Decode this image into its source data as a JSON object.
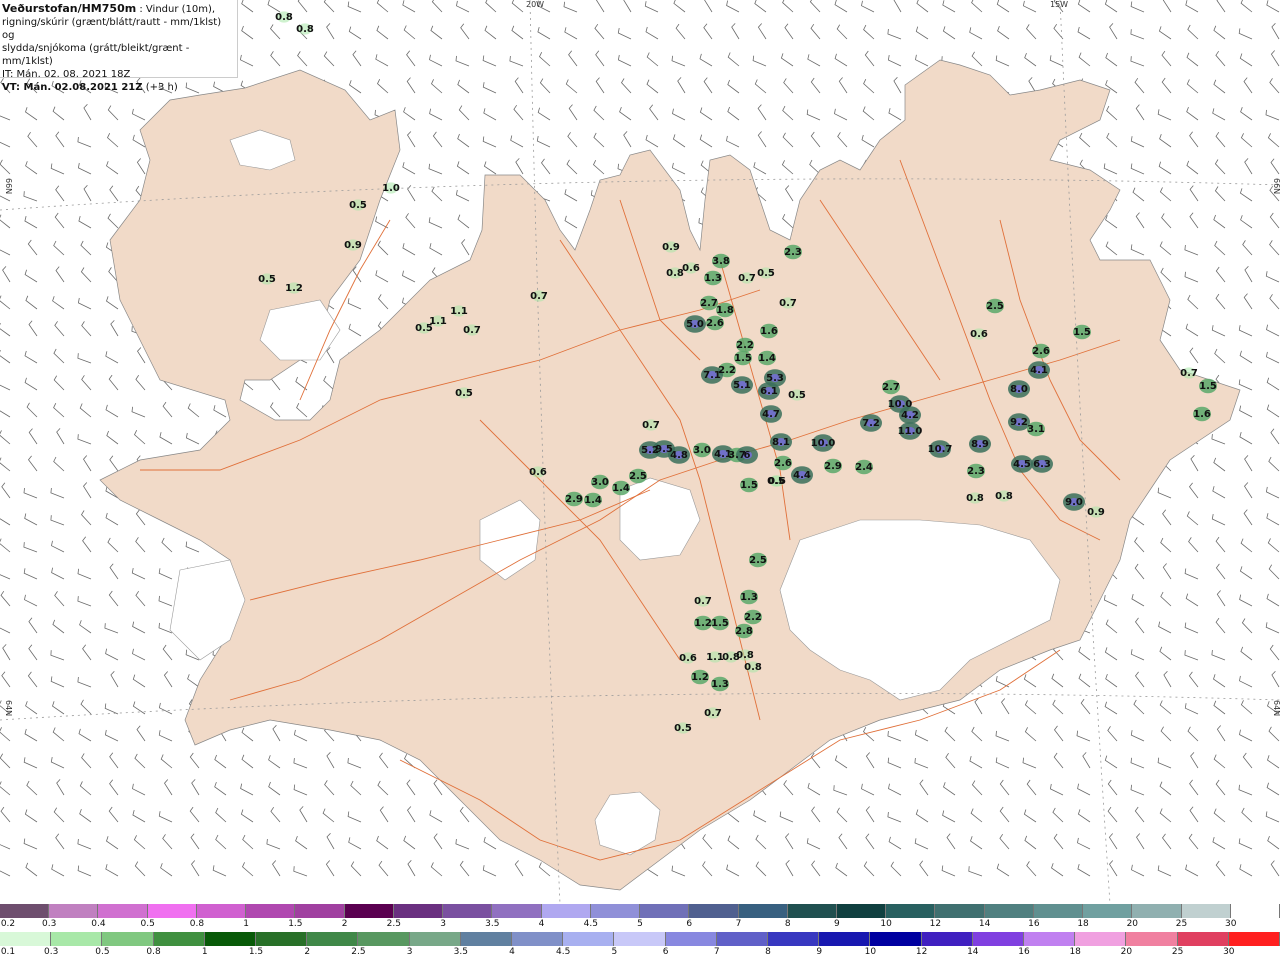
{
  "header": {
    "org": "Veðurstofan/HM750m",
    "desc1": " : Vindur (10m),",
    "desc2": "rigning/skúrir (grænt/blátt/rautt - mm/1klst) og",
    "desc3": "slydda/snjókoma (grátt/bleikt/grænt - mm/1klst)",
    "it": "IT: Mán. 02. 08. 2021 18Z",
    "vt": "VT: Mán. 02.08.2021 21Z",
    "vt_extra": " (+3 h)"
  },
  "grid_labels": {
    "lon_20w": "20W",
    "lon_15w": "15W",
    "lat_66n_left": "66N",
    "lat_66n_right": "66N",
    "lat_64n_left": "64N",
    "lat_64n_right": "64N"
  },
  "colors": {
    "land": "#f1dac8",
    "glacier": "#ffffff",
    "road": "#e0703a",
    "barb": "#6a6a6a",
    "grid": "#9a9a9a"
  },
  "precip_values": [
    {
      "label": "0.8",
      "level": "low"
    },
    {
      "label": "0.8",
      "level": "low"
    },
    {
      "label": "1.0",
      "level": "low"
    },
    {
      "label": "0.5",
      "level": "low"
    },
    {
      "label": "0.9",
      "level": "low"
    },
    {
      "label": "0.5",
      "level": "low"
    },
    {
      "label": "1.2",
      "level": "low"
    },
    {
      "label": "1.1",
      "level": "low"
    },
    {
      "label": "0.5",
      "level": "low"
    },
    {
      "label": "1.1",
      "level": "low"
    },
    {
      "label": "0.7",
      "level": "low"
    },
    {
      "label": "0.5",
      "level": "low"
    },
    {
      "label": "0.7",
      "level": "low"
    },
    {
      "label": "0.6",
      "level": "low"
    },
    {
      "label": "0.9",
      "level": "low"
    },
    {
      "label": "0.8",
      "level": "low"
    },
    {
      "label": "0.6",
      "level": "low"
    },
    {
      "label": "3.8",
      "level": "mid"
    },
    {
      "label": "1.3",
      "level": "mid"
    },
    {
      "label": "0.7",
      "level": "low"
    },
    {
      "label": "0.5",
      "level": "low"
    },
    {
      "label": "2.7",
      "level": "mid"
    },
    {
      "label": "1.8",
      "level": "mid"
    },
    {
      "label": "5.0",
      "level": "high"
    },
    {
      "label": "2.6",
      "level": "mid"
    },
    {
      "label": "2.3",
      "level": "mid"
    },
    {
      "label": "0.7",
      "level": "low"
    },
    {
      "label": "1.6",
      "level": "mid"
    },
    {
      "label": "2.2",
      "level": "mid"
    },
    {
      "label": "1.5",
      "level": "mid"
    },
    {
      "label": "1.4",
      "level": "mid"
    },
    {
      "label": "2.2",
      "level": "mid"
    },
    {
      "label": "7.1",
      "level": "high"
    },
    {
      "label": "5.3",
      "level": "high"
    },
    {
      "label": "6.1",
      "level": "high"
    },
    {
      "label": "5.1",
      "level": "high"
    },
    {
      "label": "0.5",
      "level": "low"
    },
    {
      "label": "4.7",
      "level": "high"
    },
    {
      "label": "0.7",
      "level": "low"
    },
    {
      "label": "5.2",
      "level": "high"
    },
    {
      "label": "9.5",
      "level": "high"
    },
    {
      "label": "4.8",
      "level": "high"
    },
    {
      "label": "3.0",
      "level": "mid"
    },
    {
      "label": "4.1",
      "level": "high"
    },
    {
      "label": "3.7",
      "level": "mid"
    },
    {
      "label": "6",
      "level": "high"
    },
    {
      "label": "8.1",
      "level": "high"
    },
    {
      "label": "10.0",
      "level": "high"
    },
    {
      "label": "7.2",
      "level": "high"
    },
    {
      "label": "2.6",
      "level": "mid"
    },
    {
      "label": "2.9",
      "level": "mid"
    },
    {
      "label": "2.4",
      "level": "mid"
    },
    {
      "label": "0.6",
      "level": "low"
    },
    {
      "label": "2.5",
      "level": "mid"
    },
    {
      "label": "2.9",
      "level": "mid"
    },
    {
      "label": "1.4",
      "level": "mid"
    },
    {
      "label": "3.0",
      "level": "mid"
    },
    {
      "label": "1.4",
      "level": "mid"
    },
    {
      "label": "1.5",
      "level": "mid"
    },
    {
      "label": "0.5",
      "level": "low"
    },
    {
      "label": "4.4",
      "level": "high"
    },
    {
      "label": "2.7",
      "level": "mid"
    },
    {
      "label": "10.0",
      "level": "high"
    },
    {
      "label": "4.2",
      "level": "high"
    },
    {
      "label": "11.0",
      "level": "high"
    },
    {
      "label": "10.7",
      "level": "high"
    },
    {
      "label": "8.9",
      "level": "high"
    },
    {
      "label": "2.3",
      "level": "mid"
    },
    {
      "label": "0.8",
      "level": "low"
    },
    {
      "label": "0.8",
      "level": "low"
    },
    {
      "label": "2.5",
      "level": "mid"
    },
    {
      "label": "0.6",
      "level": "low"
    },
    {
      "label": "2.6",
      "level": "mid"
    },
    {
      "label": "4.1",
      "level": "high"
    },
    {
      "label": "8.0",
      "level": "high"
    },
    {
      "label": "9.2",
      "level": "high"
    },
    {
      "label": "3.1",
      "level": "mid"
    },
    {
      "label": "4.5",
      "level": "high"
    },
    {
      "label": "6.3",
      "level": "high"
    },
    {
      "label": "9.0",
      "level": "high"
    },
    {
      "label": "0.9",
      "level": "low"
    },
    {
      "label": "1.5",
      "level": "mid"
    },
    {
      "label": "0.7",
      "level": "low"
    },
    {
      "label": "1.5",
      "level": "mid"
    },
    {
      "label": "1.6",
      "level": "mid"
    },
    {
      "label": "2.5",
      "level": "mid"
    },
    {
      "label": "0.7",
      "level": "low"
    },
    {
      "label": "1.3",
      "level": "mid"
    },
    {
      "label": "1.2",
      "level": "mid"
    },
    {
      "label": "1.5",
      "level": "mid"
    },
    {
      "label": "2.2",
      "level": "mid"
    },
    {
      "label": "2.8",
      "level": "mid"
    },
    {
      "label": "0.6",
      "level": "low"
    },
    {
      "label": "1.1",
      "level": "low"
    },
    {
      "label": "0.8",
      "level": "low"
    },
    {
      "label": "0.8",
      "level": "low"
    },
    {
      "label": "0.8",
      "level": "low"
    },
    {
      "label": "1.2",
      "level": "mid"
    },
    {
      "label": "1.3",
      "level": "mid"
    },
    {
      "label": "0.7",
      "level": "low"
    },
    {
      "label": "0.5",
      "level": "low"
    }
  ],
  "legend_snow": {
    "labels": [
      "0.2",
      "0.3",
      "0.4",
      "0.5",
      "0.8",
      "1",
      "1.5",
      "2",
      "2.5",
      "3",
      "3.5",
      "4",
      "4.5",
      "5",
      "6",
      "7",
      "8",
      "9",
      "10",
      "12",
      "14",
      "16",
      "18",
      "20",
      "25",
      "30"
    ],
    "colors": [
      "#6e4e6e",
      "#c080c0",
      "#d070d0",
      "#f070f0",
      "#d060d0",
      "#b048b0",
      "#a040a0",
      "#5a0050",
      "#6a3080",
      "#7a50a0",
      "#9070c0",
      "#b0a8f0",
      "#9090d8",
      "#7070b8",
      "#506090",
      "#386080",
      "#205050",
      "#104040",
      "#286060",
      "#407070",
      "#508080",
      "#609090",
      "#70a0a0",
      "#90b0b0",
      "#c0d0d0",
      "#ffffff"
    ]
  },
  "legend_rain": {
    "labels": [
      "0.1",
      "0.3",
      "0.5",
      "0.8",
      "1",
      "1.5",
      "2",
      "2.5",
      "3",
      "3.5",
      "4",
      "4.5",
      "5",
      "6",
      "7",
      "8",
      "9",
      "10",
      "12",
      "14",
      "16",
      "18",
      "20",
      "25",
      "30"
    ],
    "colors": [
      "#d8f8d8",
      "#a8e8a8",
      "#80c880",
      "#409040",
      "#085a08",
      "#287028",
      "#408848",
      "#589860",
      "#78a888",
      "#6080a0",
      "#8090c8",
      "#a8b0f0",
      "#c8c8f8",
      "#8888e0",
      "#6060c8",
      "#3838c0",
      "#1818b0",
      "#0000a0",
      "#4020c0",
      "#8040e0",
      "#c080f0",
      "#f0a0e0",
      "#f080a0",
      "#e04060",
      "#ff2020"
    ]
  }
}
